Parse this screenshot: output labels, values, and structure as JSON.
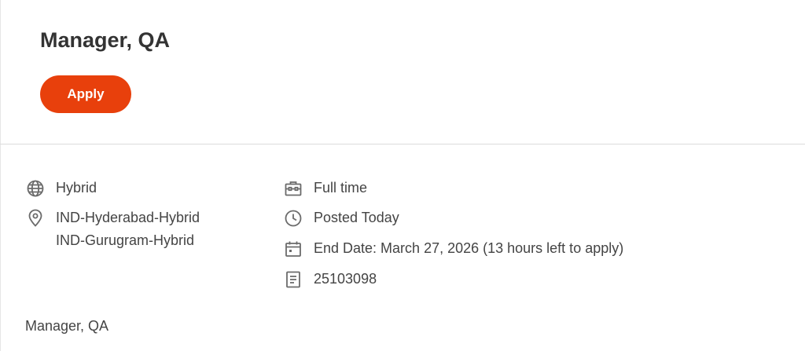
{
  "job": {
    "title": "Manager, QA",
    "apply_label": "Apply"
  },
  "details": {
    "workplace": "Hybrid",
    "locations": [
      "IND-Hyderabad-Hybrid",
      "IND-Gurugram-Hybrid"
    ],
    "employment_type": "Full time",
    "posted": "Posted Today",
    "end_date": "End Date: March 27, 2026 (13 hours left to apply)",
    "job_id": "25103098"
  },
  "description": {
    "first_line": "Manager, QA"
  },
  "colors": {
    "apply_button": "#e8400c",
    "text": "#444444",
    "icon": "#6b6b6b"
  },
  "icons": {
    "workplace": "globe-icon",
    "location": "location-pin-icon",
    "employment_type": "briefcase-icon",
    "posted": "clock-icon",
    "end_date": "calendar-icon",
    "job_id": "document-icon"
  }
}
